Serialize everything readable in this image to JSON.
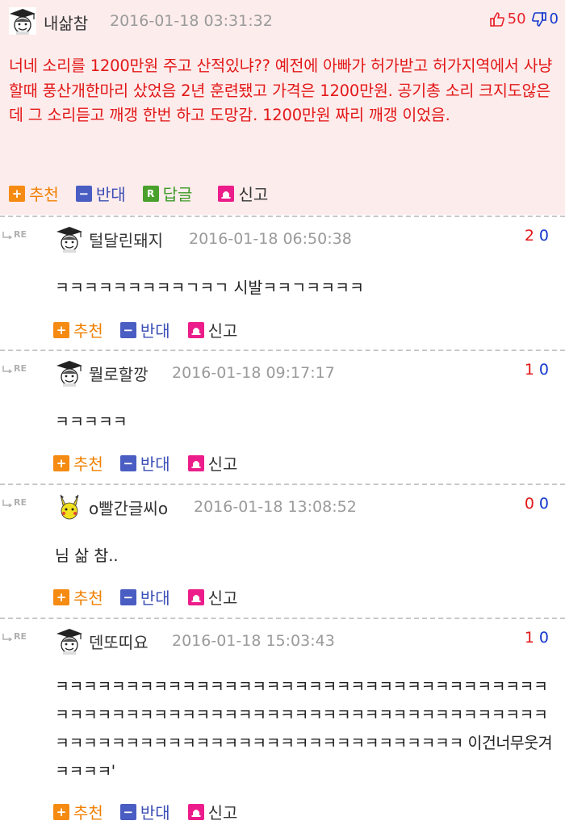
{
  "best": {
    "nick": "내삶참",
    "date": "2016-01-18 03:31:32",
    "likes": "50",
    "dislikes": "0",
    "text": "너네 소리를 1200만원 주고 산적있냐?? 예전에 아빠가 허가받고 허가지역에서 사냥할때 풍산개한마리 샀었음 2년 훈련됐고 가격은 1200만원. 공기총 소리 크지도않은데 그 소리듣고 깨갱 한번 하고 도망감. 1200만원 짜리 깨갱 이었음."
  },
  "actions": {
    "recommend": "추천",
    "oppose": "반대",
    "reply": "답글",
    "report": "신고",
    "re_marker": "RE"
  },
  "comments": [
    {
      "nick": "털달린돼지",
      "date": "2016-01-18 06:50:38",
      "up": "2",
      "down": "0",
      "text": "ㅋㅋㅋㅋㅋㅋㅋㅋㅋㄱㅋㄱ 시발ㅋㅋㄱㅋㅋㅋㅋ"
    },
    {
      "nick": "뭘로할깡",
      "date": "2016-01-18 09:17:17",
      "up": "1",
      "down": "0",
      "text": "ㅋㅋㅋㅋㅋ"
    },
    {
      "nick": "o빨간글씨o",
      "date": "2016-01-18 13:08:52",
      "up": "0",
      "down": "0",
      "text": "님 삶 참.."
    },
    {
      "nick": "덴또띠요",
      "date": "2016-01-18 15:03:43",
      "up": "1",
      "down": "0",
      "text": "ㅋㅋㅋㅋㅋㅋㅋㅋㅋㅋㅋㅋㅋㅋㅋㅋㅋㅋㅋㅋㅋㅋㅋㅋㅋㅋㅋㅋㅋㅋㅋㅋㅋㅋㅋㅋㅋㅋㅋㅋㅋㅋㅋㅋㅋㅋㅋㅋㅋㅋㅋㅋㅋㅋㅋㅋㅋㅋㅋㅋㅋㅋㅋㅋㅋㅋㅋㅋㅋㅋㅋㅋㅋㅋㅋㅋㅋㅋㅋㅋㅋㅋㅋㅋㅋㅋㅋㅋㅋㅋㅋㅋㅋㅋㅋㅋㅋㅋㅋ 이건너무웃겨 ㅋㅋㅋㅋ'"
    }
  ]
}
